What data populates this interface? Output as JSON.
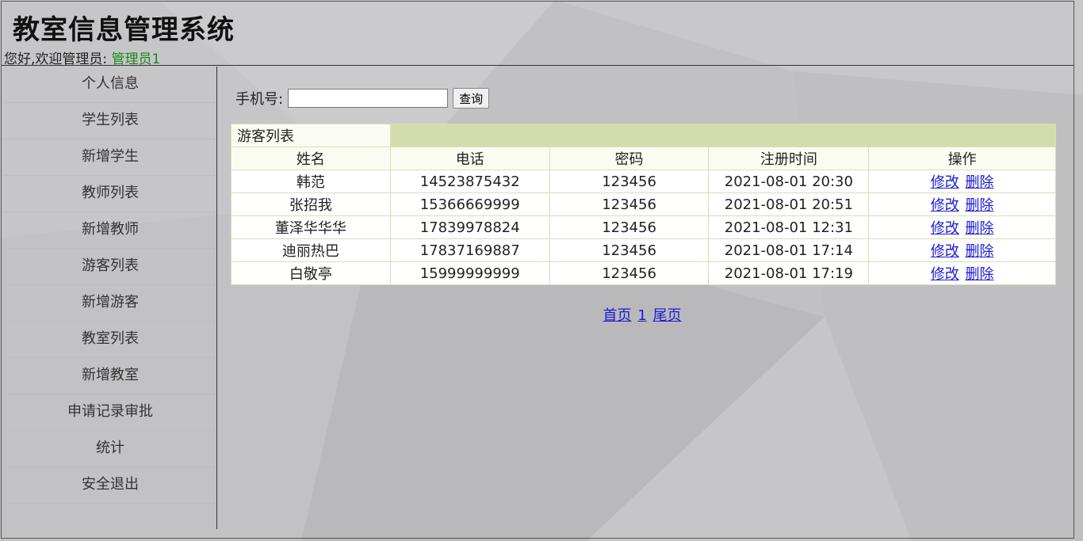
{
  "header": {
    "title": "教室信息管理系统",
    "welcome_prefix": "您好,欢迎管理员:",
    "admin_name": "管理员1"
  },
  "sidebar": {
    "items": [
      {
        "label": "个人信息"
      },
      {
        "label": "学生列表"
      },
      {
        "label": "新增学生"
      },
      {
        "label": "教师列表"
      },
      {
        "label": "新增教师"
      },
      {
        "label": "游客列表"
      },
      {
        "label": "新增游客"
      },
      {
        "label": "教室列表"
      },
      {
        "label": "新增教室"
      },
      {
        "label": "申请记录审批"
      },
      {
        "label": "统计"
      },
      {
        "label": "安全退出"
      }
    ]
  },
  "search": {
    "label": "手机号:",
    "value": "",
    "placeholder": "",
    "button_label": "查询"
  },
  "table": {
    "caption": "游客列表",
    "columns": [
      "姓名",
      "电话",
      "密码",
      "注册时间",
      "操作"
    ],
    "edit_label": "修改",
    "delete_label": "删除",
    "rows": [
      {
        "name": "韩范",
        "phone": "14523875432",
        "password": "123456",
        "registered": "2021-08-01 20:30"
      },
      {
        "name": "张招我",
        "phone": "15366669999",
        "password": "123456",
        "registered": "2021-08-01 20:51"
      },
      {
        "name": "董泽华华华",
        "phone": "17839978824",
        "password": "123456",
        "registered": "2021-08-01 12:31"
      },
      {
        "name": "迪丽热巴",
        "phone": "17837169887",
        "password": "123456",
        "registered": "2021-08-01 17:14"
      },
      {
        "name": "白敬亭",
        "phone": "15999999999",
        "password": "123456",
        "registered": "2021-08-01 17:19"
      }
    ]
  },
  "pager": {
    "first": "首页",
    "page": "1",
    "last": "尾页"
  },
  "colors": {
    "link": "#1a1ad6",
    "admin_name": "#1a8a1a",
    "caption_bar": "#d3ddab",
    "header_row": "#fbfcf1"
  }
}
